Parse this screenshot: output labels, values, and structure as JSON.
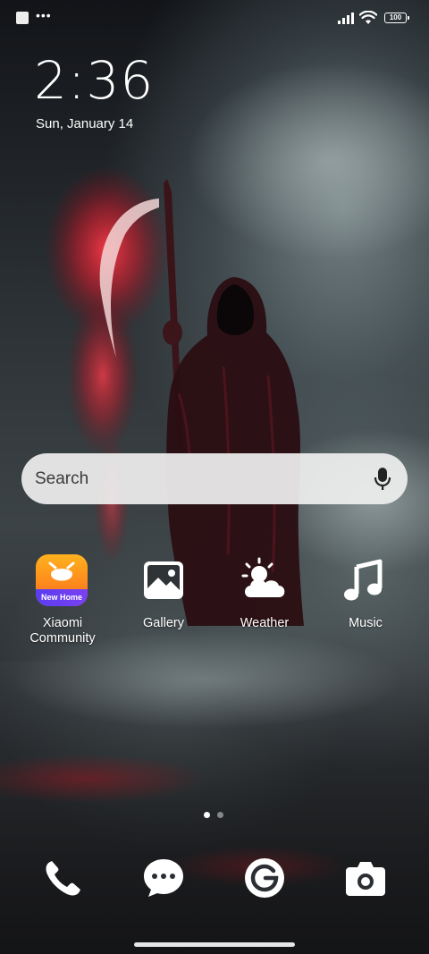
{
  "status_bar": {
    "overflow_icon": "more-dots-icon",
    "battery": "100"
  },
  "clock": {
    "time": "2:36",
    "date": "Sun, January 14"
  },
  "search": {
    "placeholder": "Search",
    "icon": "mic-icon"
  },
  "apps": [
    {
      "label": "Xiaomi Community",
      "icon": "xiaomi-community-icon",
      "badge": "New Home"
    },
    {
      "label": "Gallery",
      "icon": "gallery-icon"
    },
    {
      "label": "Weather",
      "icon": "weather-icon"
    },
    {
      "label": "Music",
      "icon": "music-icon"
    }
  ],
  "page_indicator": {
    "pages": 2,
    "current": 1
  },
  "dock": [
    {
      "icon": "phone-icon"
    },
    {
      "icon": "messages-icon"
    },
    {
      "icon": "google-icon"
    },
    {
      "icon": "camera-icon"
    }
  ],
  "colors": {
    "text": "#ffffff",
    "search_bg": "#eeeeee",
    "community_orange": "#ff8a1c",
    "community_badge": "#5a3df0",
    "reaper_red": "#ff3344"
  }
}
